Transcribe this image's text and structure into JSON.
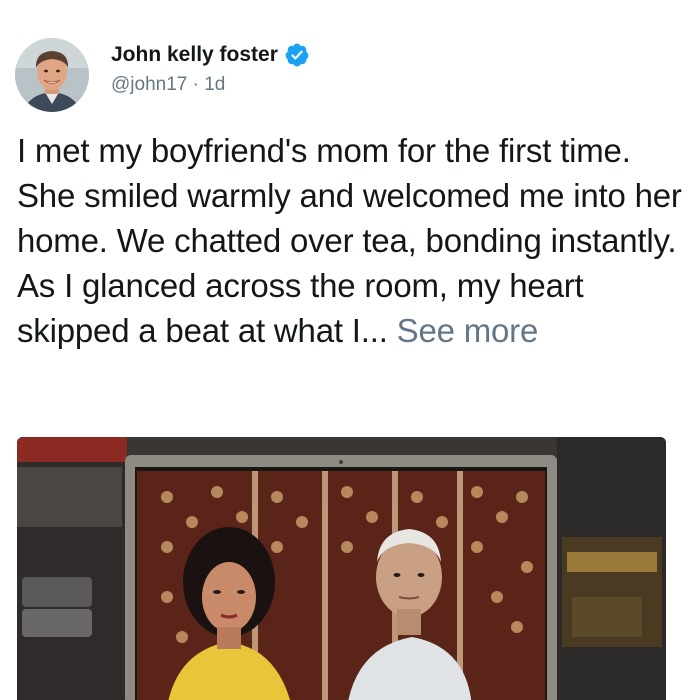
{
  "author": {
    "display_name": "John kelly foster",
    "handle": "@john17",
    "separator": "·",
    "time": "1d",
    "verified": true,
    "verified_color": "#1da1f2"
  },
  "tweet": {
    "text": "I met my boyfriend's mom for the first time. She smiled warmly and welcomed me into her home. We chatted over tea, bonding instantly. As I glanced across the room, my heart skipped a beat at what I...",
    "see_more": "See more"
  },
  "media": {
    "description_icon": "photo-of-laptop-screen"
  },
  "colors": {
    "text": "#14171a",
    "secondary": "#657786",
    "verified": "#1da1f2"
  }
}
